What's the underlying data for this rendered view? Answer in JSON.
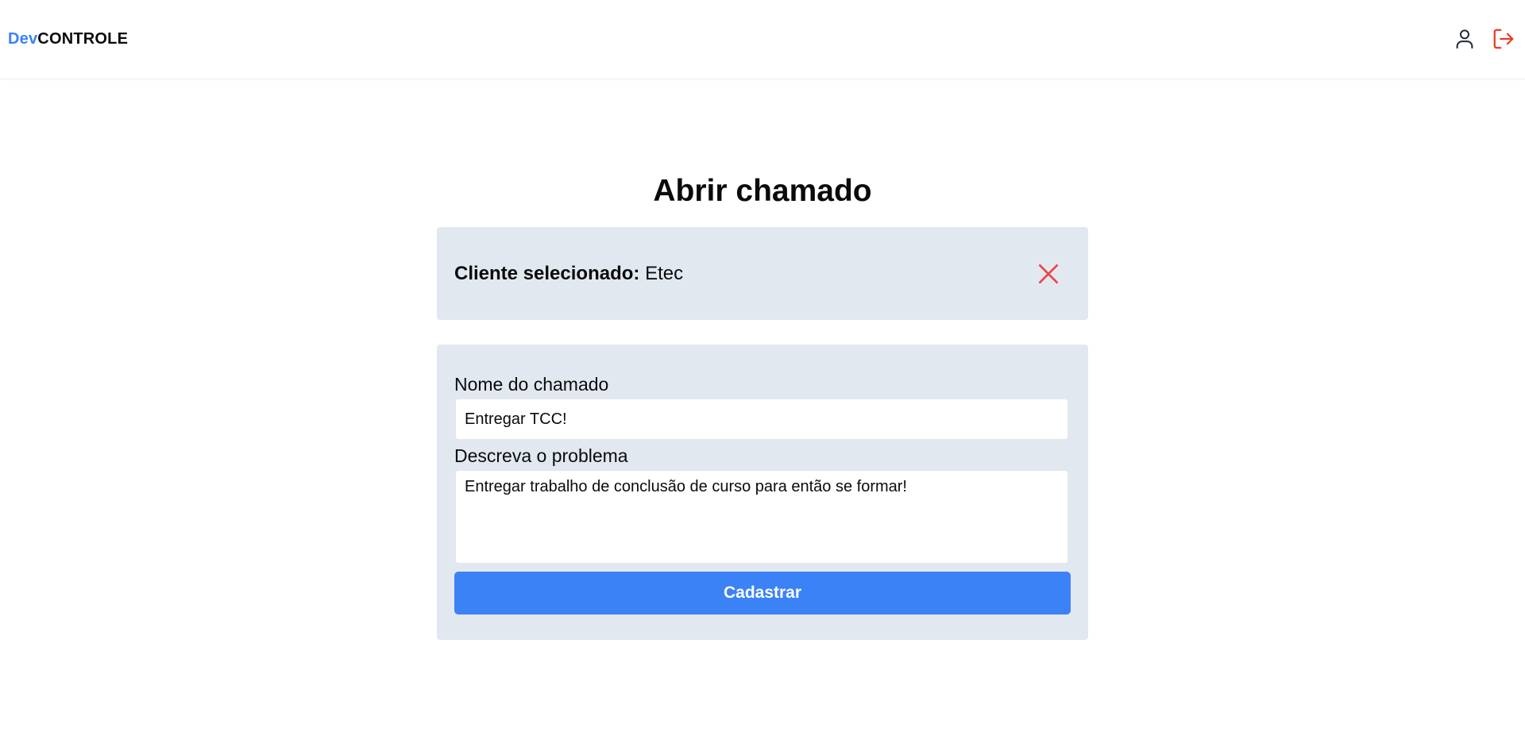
{
  "header": {
    "logo_prefix": "Dev",
    "logo_suffix": "CONTROLE",
    "icons": {
      "user": "user-icon",
      "logout": "logout-icon"
    }
  },
  "page": {
    "title": "Abrir chamado"
  },
  "client": {
    "label": "Cliente selecionado:",
    "value": "Etec",
    "clear_icon": "close-icon"
  },
  "form": {
    "name_label": "Nome do chamado",
    "name_value": "Entregar TCC!",
    "description_label": "Descreva o problema",
    "description_value": "Entregar trabalho de conclusão de curso para então se formar!",
    "submit_label": "Cadastrar"
  },
  "colors": {
    "brand": "#3b82f6",
    "logout": "#ea3a1f",
    "danger": "#ef4444",
    "card_bg": "#e2e8f0"
  }
}
